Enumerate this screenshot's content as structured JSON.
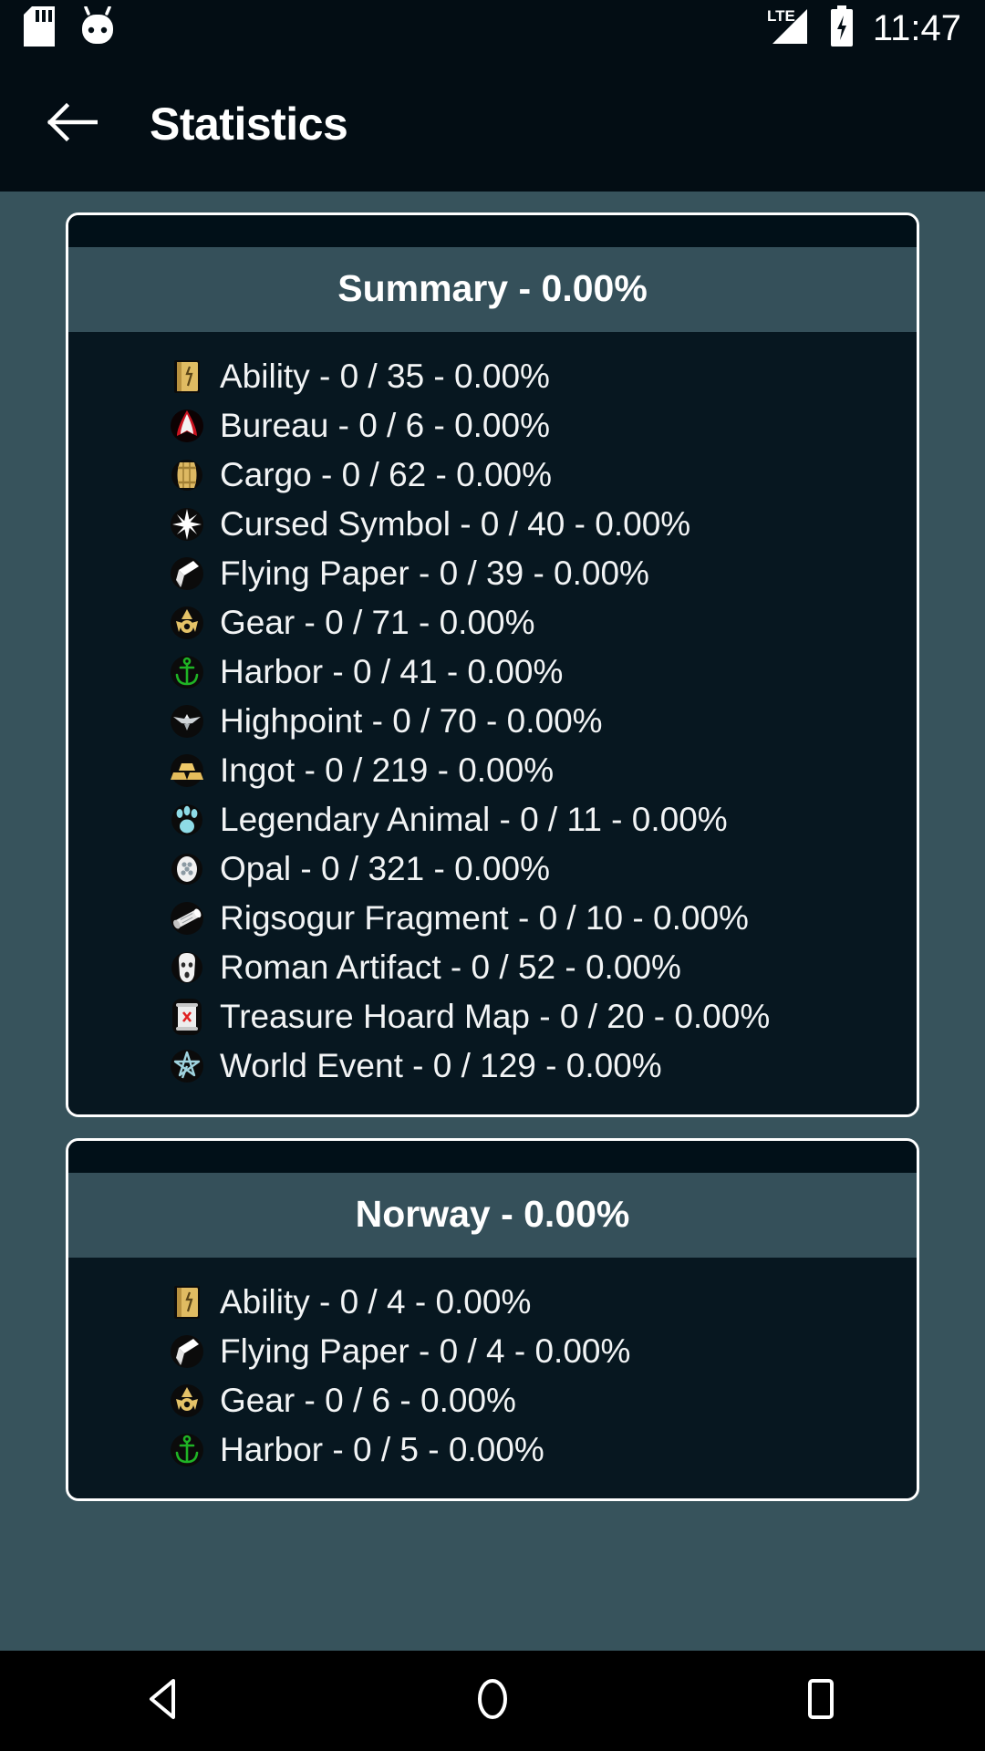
{
  "status_bar": {
    "icons_left": [
      "sd-card-icon",
      "android-marshmallow-icon"
    ],
    "network_label": "LTE",
    "icons_right": [
      "signal-bar-icon",
      "battery-charging-icon"
    ],
    "time": "11:47"
  },
  "app_bar": {
    "back_icon": "back-arrow-icon",
    "title": "Statistics"
  },
  "cards": [
    {
      "header": "Summary - 0.00%",
      "rows": [
        {
          "icon": "ability-book-icon",
          "text": "Ability - 0 / 35 - 0.00%"
        },
        {
          "icon": "bureau-insignia-icon",
          "text": "Bureau - 0 / 6 - 0.00%"
        },
        {
          "icon": "cargo-barrel-icon",
          "text": "Cargo - 0 / 62 - 0.00%"
        },
        {
          "icon": "cursed-symbol-icon",
          "text": "Cursed Symbol - 0 / 40 - 0.00%"
        },
        {
          "icon": "flying-paper-icon",
          "text": "Flying Paper - 0 / 39 - 0.00%"
        },
        {
          "icon": "gear-icon",
          "text": "Gear - 0 / 71 - 0.00%"
        },
        {
          "icon": "harbor-anchor-icon",
          "text": "Harbor - 0 / 41 - 0.00%"
        },
        {
          "icon": "highpoint-eagle-icon",
          "text": "Highpoint - 0 / 70 - 0.00%"
        },
        {
          "icon": "ingot-bars-icon",
          "text": "Ingot - 0 / 219 - 0.00%"
        },
        {
          "icon": "legendary-animal-paw-icon",
          "text": "Legendary Animal - 0 / 11 - 0.00%"
        },
        {
          "icon": "opal-gem-icon",
          "text": "Opal - 0 / 321 - 0.00%"
        },
        {
          "icon": "rigsogur-scroll-icon",
          "text": "Rigsogur Fragment - 0 / 10 - 0.00%"
        },
        {
          "icon": "roman-artifact-mask-icon",
          "text": "Roman Artifact - 0 / 52 - 0.00%"
        },
        {
          "icon": "treasure-hoard-map-icon",
          "text": "Treasure Hoard Map - 0 / 20 - 0.00%"
        },
        {
          "icon": "world-event-icon",
          "text": "World Event - 0 / 129 - 0.00%"
        }
      ]
    },
    {
      "header": "Norway - 0.00%",
      "rows": [
        {
          "icon": "ability-book-icon",
          "text": "Ability - 0 / 4 - 0.00%"
        },
        {
          "icon": "flying-paper-icon",
          "text": "Flying Paper - 0 / 4 - 0.00%"
        },
        {
          "icon": "gear-icon",
          "text": "Gear - 0 / 6 - 0.00%"
        },
        {
          "icon": "harbor-anchor-icon",
          "text": "Harbor - 0 / 5 - 0.00%"
        }
      ]
    }
  ],
  "nav_bar": {
    "back_label": "back-triangle-icon",
    "home_label": "home-circle-icon",
    "recents_label": "recents-square-icon"
  },
  "colors": {
    "background": "#37535c",
    "app_bar": "#030d14",
    "card_body": "#071720",
    "card_header": "#35505a",
    "card_border": "#ffffff",
    "text": "#f2f4f5"
  }
}
